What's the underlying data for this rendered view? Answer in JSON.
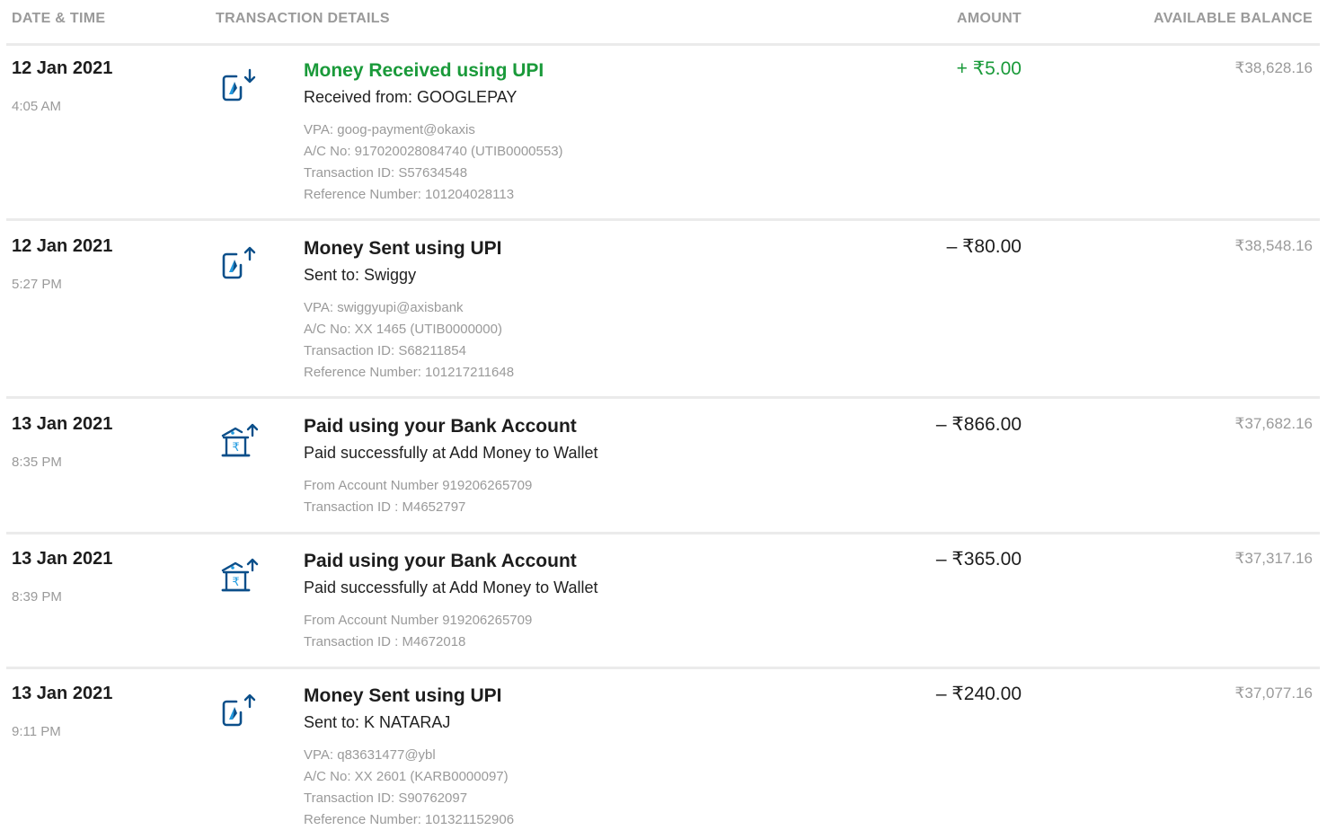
{
  "header": {
    "date_time": "DATE & TIME",
    "details": "TRANSACTION DETAILS",
    "amount": "AMOUNT",
    "balance": "AVAILABLE BALANCE"
  },
  "colors": {
    "credit": "#1a9a3a",
    "icon_blue": "#0b4f8a",
    "icon_accent": "#1f9ae0"
  },
  "transactions": [
    {
      "date": "12 Jan 2021",
      "time": "4:05 AM",
      "icon": "upi-receive-icon",
      "title": "Money Received using UPI",
      "subtitle": "Received from: GOOGLEPAY",
      "meta": [
        "VPA: goog-payment@okaxis",
        "A/C No: 917020028084740 (UTIB0000553)",
        "Transaction ID: S57634548",
        "Reference Number: 101204028113"
      ],
      "amount": "+ ₹5.00",
      "balance": "₹38,628.16"
    },
    {
      "date": "12 Jan 2021",
      "time": "5:27 PM",
      "icon": "upi-send-icon",
      "title": "Money Sent using UPI",
      "subtitle": "Sent to: Swiggy",
      "meta": [
        "VPA: swiggyupi@axisbank",
        "A/C No: XX 1465 (UTIB0000000)",
        "Transaction ID: S68211854",
        "Reference Number: 101217211648"
      ],
      "amount": "– ₹80.00",
      "balance": "₹38,548.16"
    },
    {
      "date": "13 Jan 2021",
      "time": "8:35 PM",
      "icon": "bank-pay-icon",
      "title": "Paid using your Bank Account",
      "subtitle": "Paid successfully at Add Money to Wallet",
      "meta": [
        "From Account Number 919206265709",
        "Transaction ID : M4652797"
      ],
      "amount": "– ₹866.00",
      "balance": "₹37,682.16"
    },
    {
      "date": "13 Jan 2021",
      "time": "8:39 PM",
      "icon": "bank-pay-icon",
      "title": "Paid using your Bank Account",
      "subtitle": "Paid successfully at Add Money to Wallet",
      "meta": [
        "From Account Number 919206265709",
        "Transaction ID : M4672018"
      ],
      "amount": "– ₹365.00",
      "balance": "₹37,317.16"
    },
    {
      "date": "13 Jan 2021",
      "time": "9:11 PM",
      "icon": "upi-send-icon",
      "title": "Money Sent using UPI",
      "subtitle": "Sent to: K NATARAJ",
      "meta": [
        "VPA: q83631477@ybl",
        "A/C No: XX 2601 (KARB0000097)",
        "Transaction ID: S90762097",
        "Reference Number: 101321152906"
      ],
      "amount": "– ₹240.00",
      "balance": "₹37,077.16"
    }
  ]
}
